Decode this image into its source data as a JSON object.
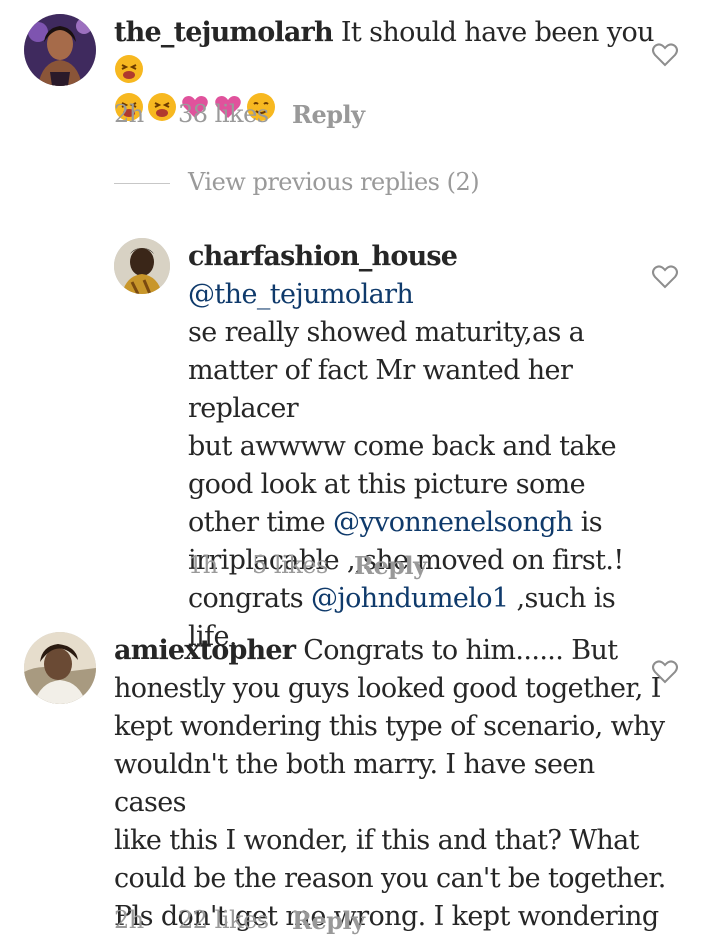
{
  "comments": [
    {
      "username": "the_tejumolarh",
      "line1": "It should have been you",
      "emojis": [
        "tired-face-emoji",
        "tired-face-emoji",
        "tired-face-emoji",
        "pink-heart-emoji",
        "pink-heart-emoji",
        "hugging-face-emoji"
      ],
      "time": "2h",
      "likes": "38 likes",
      "reply": "Reply"
    },
    {
      "username": "charfashion_house",
      "mention1": "@the_tejumolarh",
      "line2": "se really showed maturity,as a",
      "line3": "matter of fact Mr wanted her replacer",
      "line4": "but awwww come back and take",
      "line5": "good look at this picture some",
      "line6_pre": "other time ",
      "mention2": "@yvonnenelsongh",
      "line6_post": " is",
      "line7": "irriplacable ,,she moved on first.!",
      "line8_pre": "congrats ",
      "mention3": "@johndumelo1",
      "line8_post": " ,such is life.",
      "time": "1h",
      "likes": "5 likes",
      "reply": "Reply"
    },
    {
      "username": "amiextopher",
      "line1": "Congrats to him...... But",
      "line2": "honestly you guys looked good together, I",
      "line3": "kept wondering this type of scenario, why",
      "line4": "wouldn't the both marry. I have seen cases",
      "line5": "like this I wonder, if this and that? What",
      "line6": "could be the reason you can't be together.",
      "line7": "Pls don't get me wrong. I kept wondering",
      "time": "2h",
      "likes": "22 likes",
      "reply": "Reply"
    }
  ],
  "view_previous": "View previous replies (2)",
  "colors": {
    "text": "#262626",
    "mention": "#0f3a6b",
    "meta": "#9a9a9a"
  }
}
